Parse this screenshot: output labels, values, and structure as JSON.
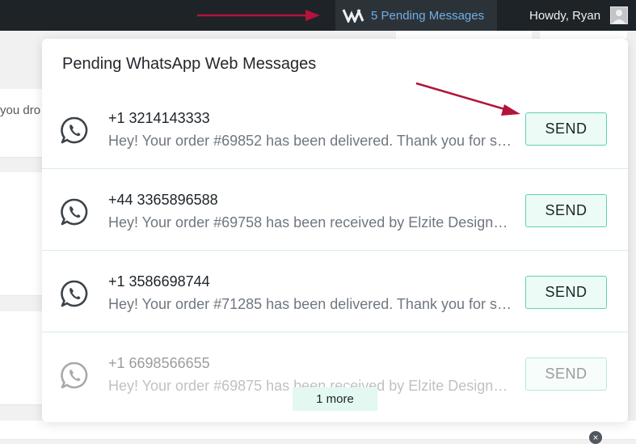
{
  "adminbar": {
    "pending_label": "5 Pending Messages",
    "howdy": "Howdy, Ryan",
    "logo_icon": "plugin-logo-icon",
    "avatar_icon": "user-avatar-icon",
    "bg_color": "#1d2327",
    "accent": "#72aee6"
  },
  "background": {
    "snippet": "you dro"
  },
  "panel": {
    "title": "Pending WhatsApp Web Messages",
    "messages": [
      {
        "phone": "+1 3214143333",
        "preview": "Hey! Your order #69852 has been delivered. Thank you for shopping with us.",
        "button": "SEND"
      },
      {
        "phone": "+44 3365896588",
        "preview": "Hey! Your order #69758 has been received by Elzite Designs and is being processed.",
        "button": "SEND"
      },
      {
        "phone": "+1 3586698744",
        "preview": "Hey! Your order #71285 has been delivered. Thank you for shopping with us.",
        "button": "SEND"
      },
      {
        "phone": "+1 6698566655",
        "preview": "Hey! Your order #69875 has been received by Elzite Designs and is being processed.",
        "button": "SEND"
      }
    ],
    "more_label": "1 more",
    "button_border": "#5fd1b0",
    "button_bg": "#ecfbf6"
  },
  "annotations": {
    "arrow_color": "#b3143a"
  }
}
